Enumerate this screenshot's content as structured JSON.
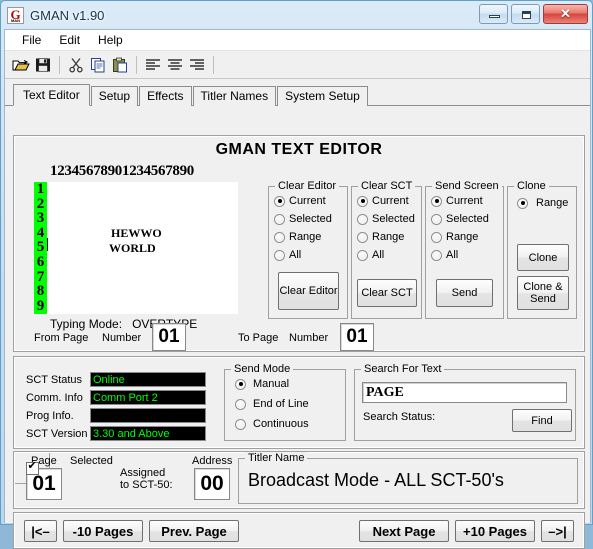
{
  "window": {
    "title": "GMAN v1.90",
    "icon": "gman-logo-icon",
    "minimize": "–",
    "maximize": "❐",
    "close": "✕"
  },
  "menu": [
    {
      "label": "File"
    },
    {
      "label": "Edit"
    },
    {
      "label": "Help"
    }
  ],
  "toolbar": [
    {
      "name": "open-icon",
      "title": "Open"
    },
    {
      "name": "save-icon",
      "title": "Save"
    },
    {
      "name": "cut-icon",
      "title": "Cut"
    },
    {
      "name": "copy-icon",
      "title": "Copy"
    },
    {
      "name": "paste-icon",
      "title": "Paste"
    },
    {
      "name": "align-left-icon",
      "title": "Align Left"
    },
    {
      "name": "align-center-icon",
      "title": "Align Center"
    },
    {
      "name": "align-right-icon",
      "title": "Align Right"
    }
  ],
  "tabs": [
    {
      "label": "Text Editor",
      "active": true
    },
    {
      "label": "Setup",
      "active": false
    },
    {
      "label": "Effects",
      "active": false
    },
    {
      "label": "Titler Names",
      "active": false
    },
    {
      "label": "System Setup",
      "active": false
    }
  ],
  "editor": {
    "heading": "GMAN TEXT EDITOR",
    "ruler": "12345678901234567890",
    "line_numbers": "123456789",
    "lines": [
      {
        "text": "HEWWO",
        "row": 4,
        "col": 8
      },
      {
        "text": "WORLD",
        "row": 5,
        "col": 8
      }
    ],
    "typing_mode_label": "Typing Mode:",
    "typing_mode_value": "OVERTYPE",
    "line_number_bg": "#00FF00"
  },
  "clear_editor": {
    "legend": "Clear Editor",
    "options": [
      {
        "label": "Current",
        "selected": true
      },
      {
        "label": "Selected",
        "selected": false
      },
      {
        "label": "Range",
        "selected": false
      },
      {
        "label": "All",
        "selected": false
      }
    ],
    "button": "Clear Editor"
  },
  "clear_sct": {
    "legend": "Clear SCT",
    "options": [
      {
        "label": "Current",
        "selected": true
      },
      {
        "label": "Selected",
        "selected": false
      },
      {
        "label": "Range",
        "selected": false
      },
      {
        "label": "All",
        "selected": false
      }
    ],
    "button": "Clear SCT"
  },
  "send_screen": {
    "legend": "Send Screen",
    "options": [
      {
        "label": "Current",
        "selected": true
      },
      {
        "label": "Selected",
        "selected": false
      },
      {
        "label": "Range",
        "selected": false
      },
      {
        "label": "All",
        "selected": false
      }
    ],
    "button": "Send"
  },
  "clone": {
    "legend": "Clone",
    "options": [
      {
        "label": "Range",
        "selected": true
      }
    ],
    "button": "Clone",
    "button2": "Clone & Send"
  },
  "page_range": {
    "from_label": "From  Page",
    "from_number_label": "Number",
    "from_value": "01",
    "to_label": "To  Page",
    "to_number_label": "Number",
    "to_value": "01"
  },
  "status": {
    "rows": [
      {
        "label": "SCT Status",
        "value": "Online"
      },
      {
        "label": "Comm. Info",
        "value": "Comm Port 2"
      },
      {
        "label": "Prog Info.",
        "value": ""
      },
      {
        "label": "SCT Version",
        "value": "3.30 and Above"
      }
    ],
    "text_color": "#00FF00",
    "bg_color": "#000000"
  },
  "send_mode": {
    "legend": "Send Mode",
    "options": [
      {
        "label": "Manual",
        "selected": true
      },
      {
        "label": "End of Line",
        "selected": false
      },
      {
        "label": "Continuous",
        "selected": false
      }
    ]
  },
  "search": {
    "legend": "Search For Text",
    "value": "PAGE",
    "placeholder": "",
    "status_label": "Search Status:",
    "status_value": "",
    "find_button": "Find"
  },
  "page_bar": {
    "page_label": "Page",
    "page_value": "01",
    "selected_label": "Selected",
    "selected_checked": true,
    "assigned_label": "Assigned\nto SCT-50:",
    "assigned_line1": "Assigned",
    "assigned_line2": "to SCT-50:",
    "address_label": "Address",
    "address_value": "00",
    "titler_legend": "Titler Name",
    "titler_value": "Broadcast Mode - ALL SCT-50's"
  },
  "nav": {
    "first": "|<–",
    "minus10": "-10 Pages",
    "prev": "Prev. Page",
    "next": "Next Page",
    "plus10": "+10 Pages",
    "last": "–>|"
  }
}
